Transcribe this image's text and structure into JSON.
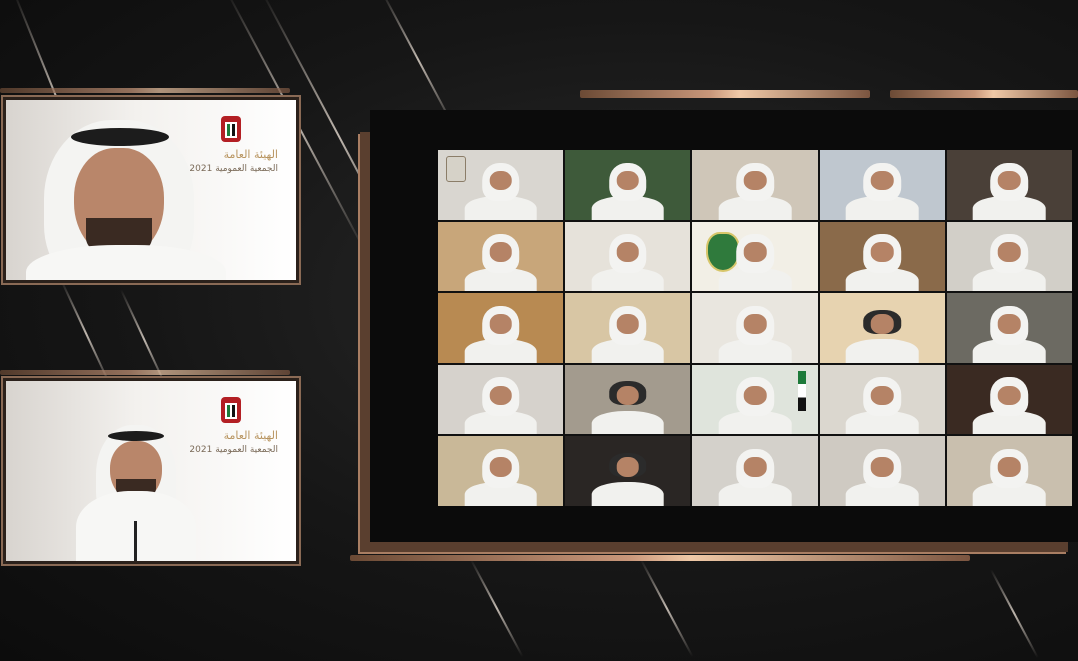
{
  "scene": {
    "type": "virtual-meeting-broadcast",
    "accent_color": "#c9977a",
    "background_color": "#141414"
  },
  "speakers": [
    {
      "id": "speaker-1",
      "logo_icon": "emirates-emblem-icon",
      "logo_title": "الهيئة العامة",
      "logo_subtitle": "الجمعية العمومية 2021"
    },
    {
      "id": "speaker-2",
      "logo_icon": "emirates-emblem-icon",
      "logo_title": "الهيئة العامة",
      "logo_subtitle": "الجمعية العمومية 2021"
    }
  ],
  "participants": {
    "rows": 5,
    "columns": 5,
    "tiles": [
      {
        "bg": "#d9d6d0"
      },
      {
        "bg": "#3e5a3a"
      },
      {
        "bg": "#cfc6b8"
      },
      {
        "bg": "#bfc7cf"
      },
      {
        "bg": "#4a4038"
      },
      {
        "bg": "#c8a67a"
      },
      {
        "bg": "#e6e2da"
      },
      {
        "bg": "#f2efe6"
      },
      {
        "bg": "#8a6a4a"
      },
      {
        "bg": "#d2cfc8"
      },
      {
        "bg": "#b88a52"
      },
      {
        "bg": "#d8c6a4"
      },
      {
        "bg": "#e9e6df"
      },
      {
        "bg": "#e7d3b0"
      },
      {
        "bg": "#6c6a62"
      },
      {
        "bg": "#d6d2cc"
      },
      {
        "bg": "#a39b8e"
      },
      {
        "bg": "#dfe4dc"
      },
      {
        "bg": "#dbd7cf"
      },
      {
        "bg": "#3a2a22"
      },
      {
        "bg": "#c9b898"
      },
      {
        "bg": "#2a2624"
      },
      {
        "bg": "#d4d1cb"
      },
      {
        "bg": "#cfcac2"
      },
      {
        "bg": "#c9bfae"
      }
    ]
  }
}
